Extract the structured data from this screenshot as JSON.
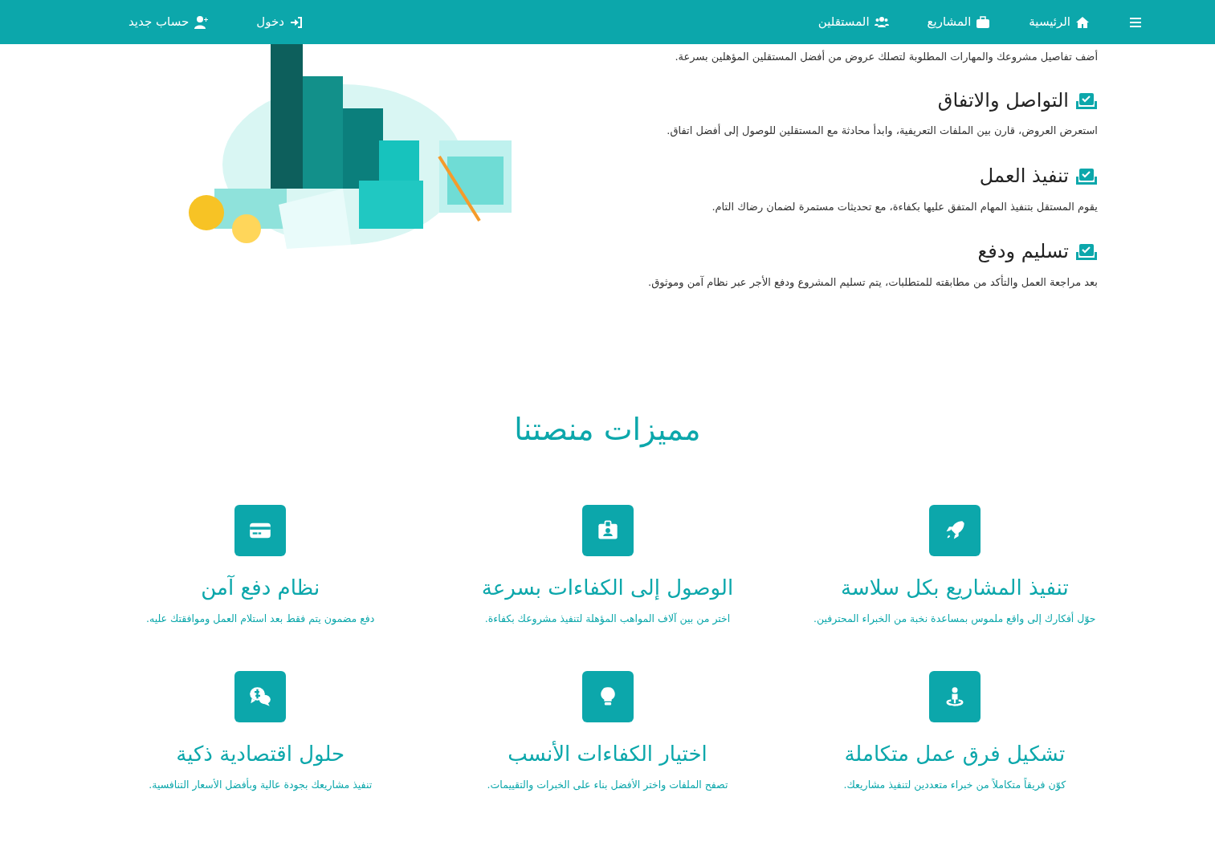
{
  "navbar": {
    "menu_items": [
      {
        "label": "الرئيسية"
      },
      {
        "label": "المشاريع"
      },
      {
        "label": "المستقلين"
      }
    ],
    "account_links": [
      {
        "label": "دخول"
      },
      {
        "label": "حساب جديد"
      }
    ]
  },
  "steps": {
    "intro": "أضف تفاصيل مشروعك والمهارات المطلوبة لتصلك عروض من أفضل المستقلين المؤهلين بسرعة.",
    "items": [
      {
        "title": "التواصل والاتفاق",
        "text": "استعرض العروض، قارن بين الملفات التعريفية، وابدأ محادثة مع المستقلين للوصول إلى أفضل اتفاق."
      },
      {
        "title": "تنفيذ العمل",
        "text": "يقوم المستقل بتنفيذ المهام المتفق عليها بكفاءة، مع تحديثات مستمرة لضمان رضاك التام."
      },
      {
        "title": "تسليم ودفع",
        "text": "بعد مراجعة العمل والتأكد من مطابقته للمتطلبات، يتم تسليم المشروع ودفع الأجر عبر نظام آمن وموثوق."
      }
    ]
  },
  "features": {
    "title": "مميزات منصتنا",
    "items": [
      {
        "title": "تنفيذ المشاريع بكل سلاسة",
        "text": "حوّل أفكارك إلى واقع ملموس بمساعدة نخبة من الخبراء المحترفين."
      },
      {
        "title": "الوصول إلى الكفاءات بسرعة",
        "text": "اختر من بين آلاف المواهب المؤهلة لتنفيذ مشروعك بكفاءة."
      },
      {
        "title": "نظام دفع آمن",
        "text": "دفع مضمون يتم فقط بعد استلام العمل وموافقتك عليه."
      },
      {
        "title": "تشكيل فرق عمل متكاملة",
        "text": "كوّن فريقاً متكاملاً من خبراء متعددين لتنفيذ مشاريعك."
      },
      {
        "title": "اختيار الكفاءات الأنسب",
        "text": "تصفح الملفات واختر الأفضل بناء على الخبرات والتقييمات."
      },
      {
        "title": "حلول اقتصادية ذكية",
        "text": "تنفيذ مشاريعك بجودة عالية وبأفضل الأسعار التنافسية."
      }
    ]
  }
}
